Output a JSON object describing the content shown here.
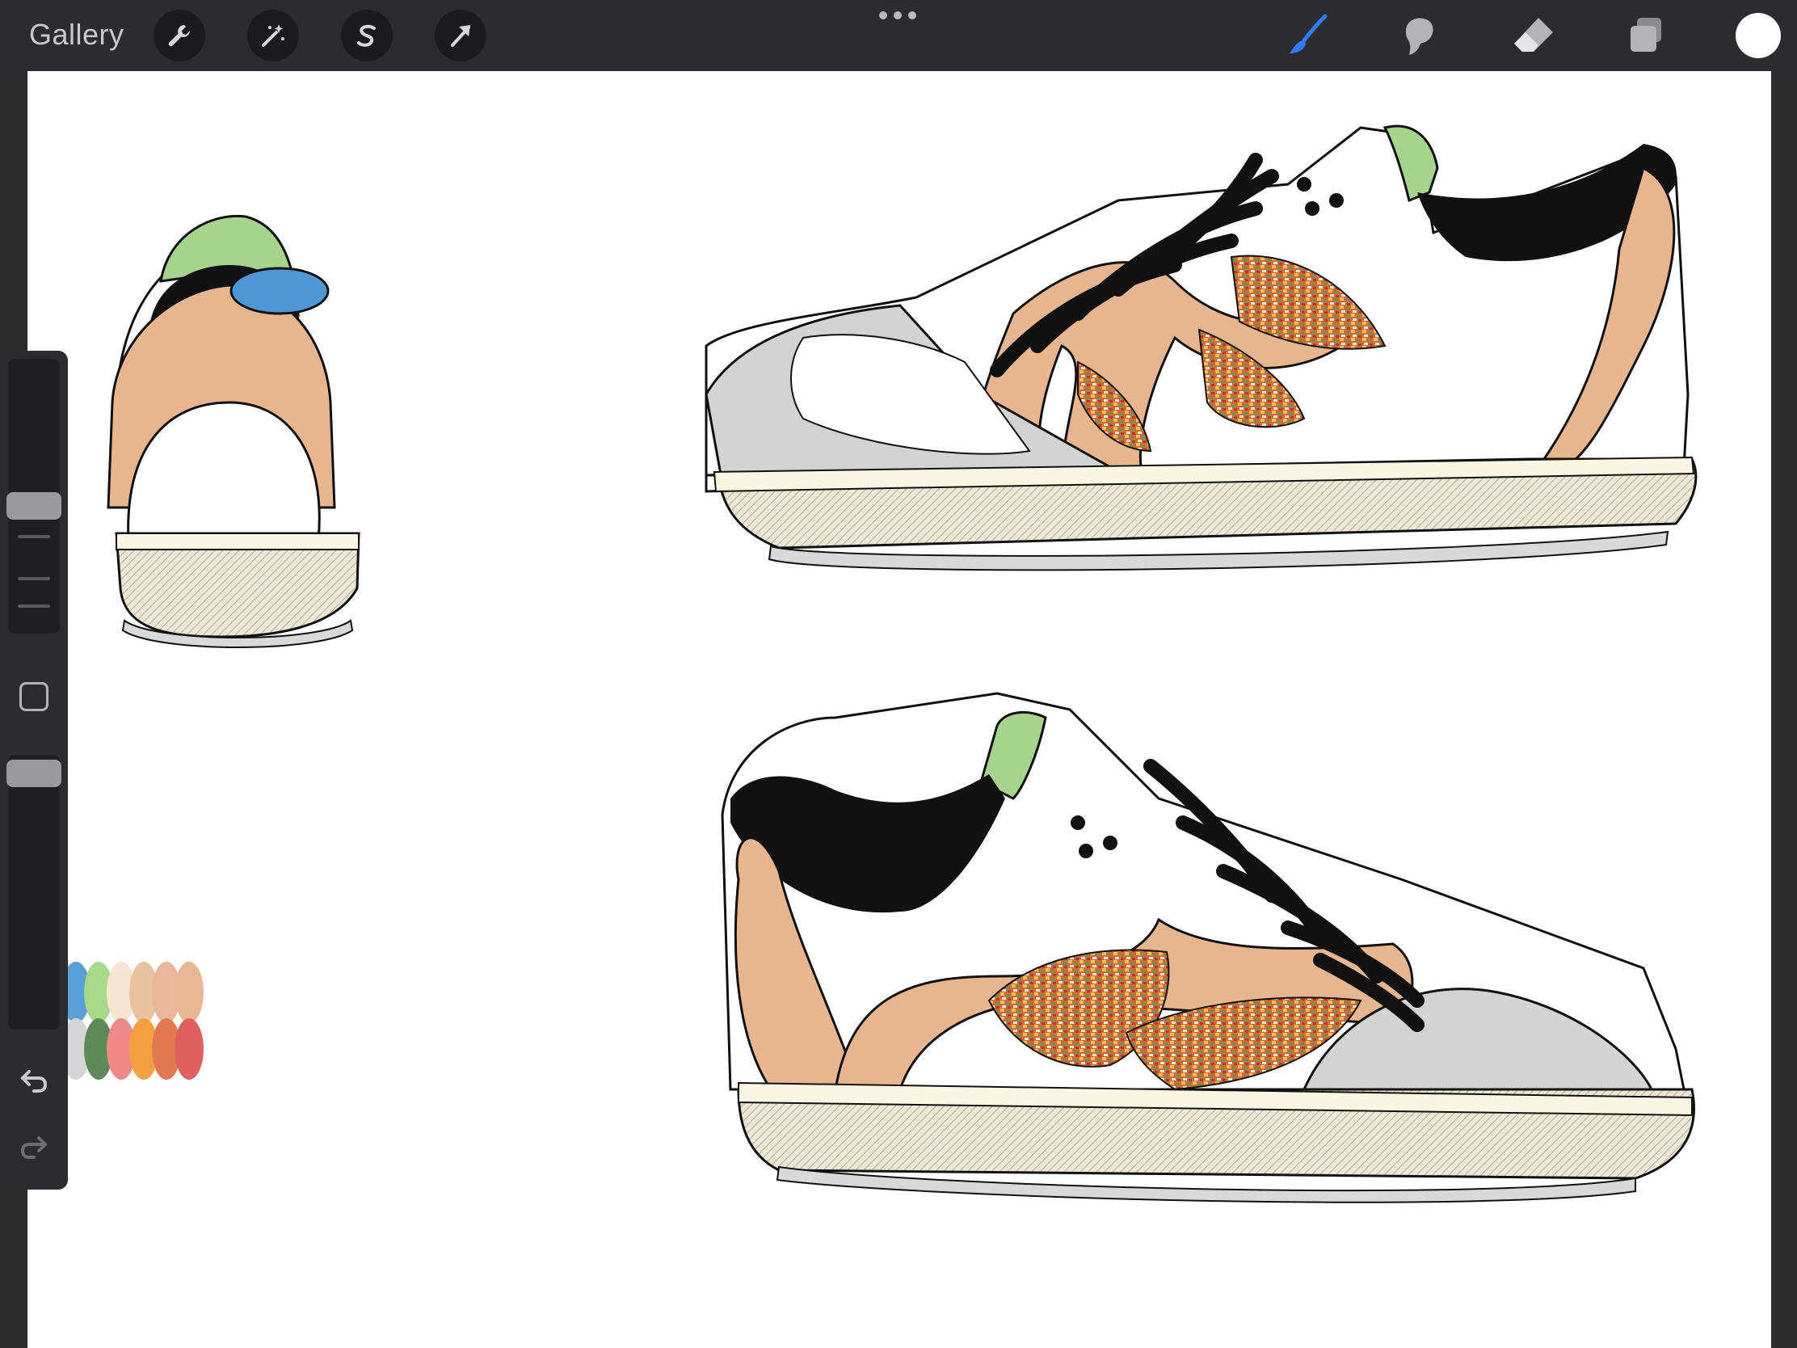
{
  "app": {
    "gallery_label": "Gallery"
  },
  "toolbar_left": [
    {
      "name": "actions-wrench-icon"
    },
    {
      "name": "adjustments-wand-icon"
    },
    {
      "name": "selection-s-icon"
    },
    {
      "name": "transform-arrow-icon"
    }
  ],
  "toolbar_right": [
    {
      "name": "brush-icon",
      "active": true
    },
    {
      "name": "smudge-icon",
      "active": false
    },
    {
      "name": "eraser-icon",
      "active": false
    },
    {
      "name": "layers-icon",
      "active": false
    }
  ],
  "colors": {
    "current_color": "#ffffff",
    "accent": "#2f7cf6",
    "toolbar_bg": "#2c2c2e",
    "canvas_bg": "#ffffff"
  },
  "palette_swatches": [
    "#5a9fd6",
    "#a8d88a",
    "#f4e6d2",
    "#e8c3a2",
    "#e8b79c",
    "#e8b895",
    "#d6d6d6",
    "#5e8a5a",
    "#f08a8a",
    "#f5a040",
    "#e07850",
    "#e06060"
  ],
  "sidebar": {
    "brush_size": 0.46,
    "brush_opacity": 0.98
  }
}
